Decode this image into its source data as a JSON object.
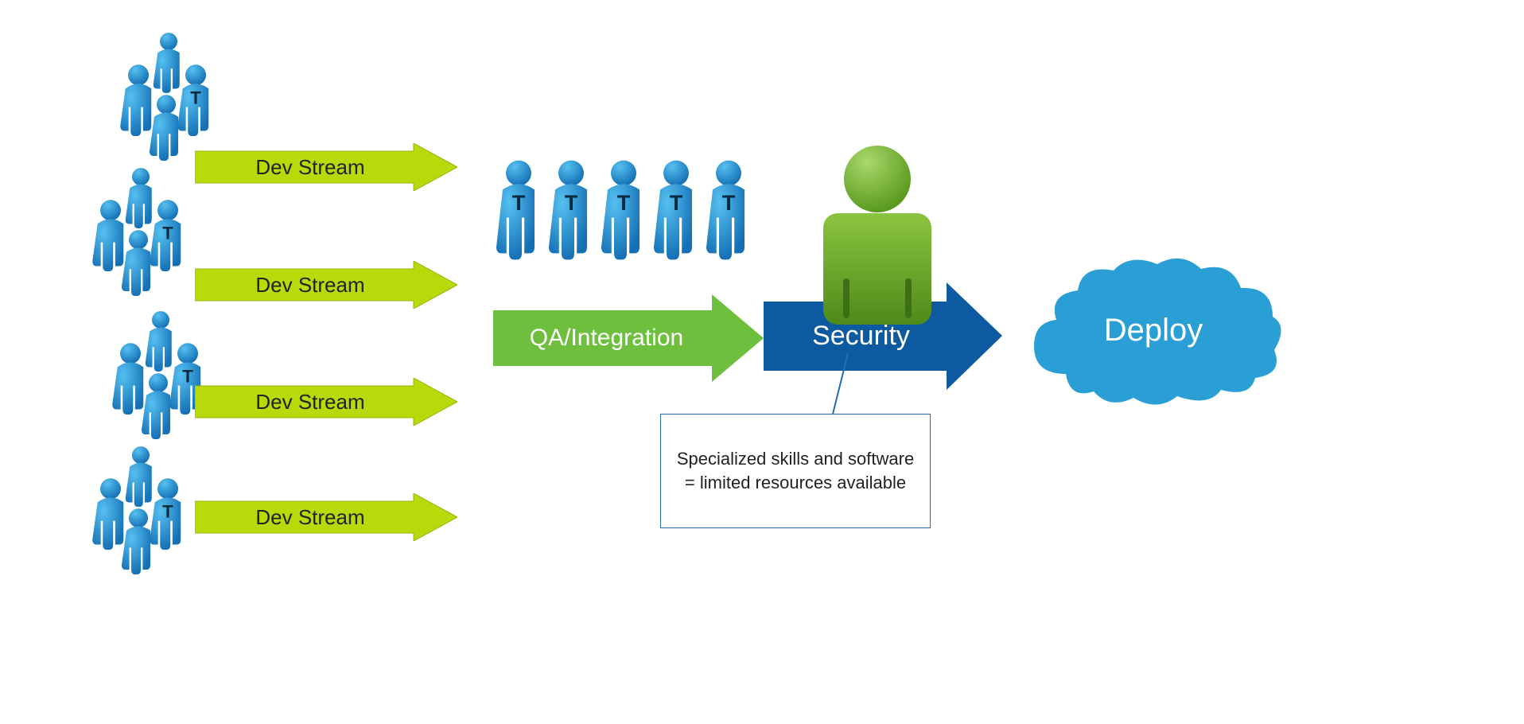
{
  "colors": {
    "devArrowFill": "#b8d90a",
    "devArrowStroke": "#9bb80a",
    "personBlueLight": "#2da0dd",
    "personBlueDark": "#1571b6",
    "personGreenLight": "#8bc53f",
    "personGreenDark": "#5a9a1f",
    "qaArrowFill": "#6fbf3e",
    "securityArrowFill": "#0e5aa0",
    "cloudFill": "#2a9fd6",
    "calloutBorder": "#1f6fb5",
    "textDark": "#222222",
    "textLight": "#ffffff"
  },
  "devStreams": [
    {
      "label": "Dev Stream"
    },
    {
      "label": "Dev Stream"
    },
    {
      "label": "Dev Stream"
    },
    {
      "label": "Dev Stream"
    }
  ],
  "qaIntegration": {
    "label": "QA/Integration",
    "testerCount": 5
  },
  "security": {
    "label": "Security"
  },
  "callout": {
    "text": "Specialized skills and software = limited resources available"
  },
  "deploy": {
    "label": "Deploy"
  }
}
